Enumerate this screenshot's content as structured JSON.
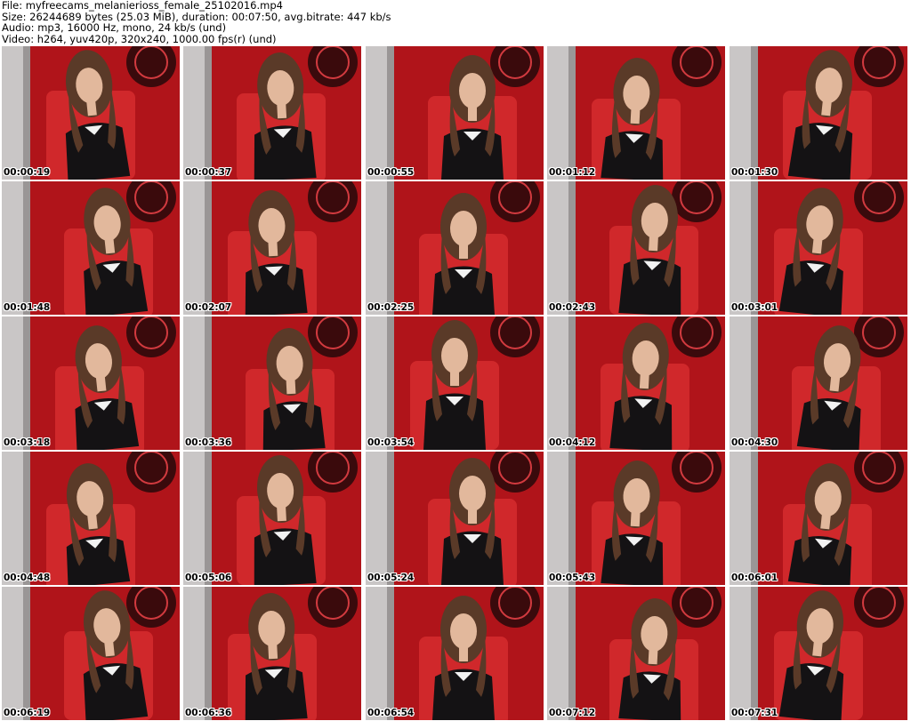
{
  "header": {
    "file_line": "File: myfreecams_melanierioss_female_25102016.mp4",
    "size_line": "Size: 26244689 bytes (25.03 MiB), duration: 00:07:50, avg.bitrate: 447 kb/s",
    "audio_line": "Audio: mp3, 16000 Hz, mono, 24 kb/s (und)",
    "video_line": "Video: h264, yuv420p, 320x240, 1000.00 fps(r) (und)"
  },
  "thumbnails": [
    "00:00:19",
    "00:00:37",
    "00:00:55",
    "00:01:12",
    "00:01:30",
    "00:01:48",
    "00:02:07",
    "00:02:25",
    "00:02:43",
    "00:03:01",
    "00:03:18",
    "00:03:36",
    "00:03:54",
    "00:04:12",
    "00:04:30",
    "00:04:48",
    "00:05:06",
    "00:05:24",
    "00:05:43",
    "00:06:01",
    "00:06:19",
    "00:06:36",
    "00:06:54",
    "00:07:12",
    "00:07:31"
  ],
  "thumbnail_icon": "video-frame-thumbnail",
  "colors": {
    "background": "#ffffff",
    "wall_red": "#b0141a",
    "curtain_gray": "#c9c6c6",
    "chair_red": "#d0282b",
    "emblem_dark": "#3a0a0c",
    "dress_black": "#141214",
    "hair_brown": "#5a3a28",
    "skin": "#e2b89c",
    "timestamp_text": "#000000"
  }
}
